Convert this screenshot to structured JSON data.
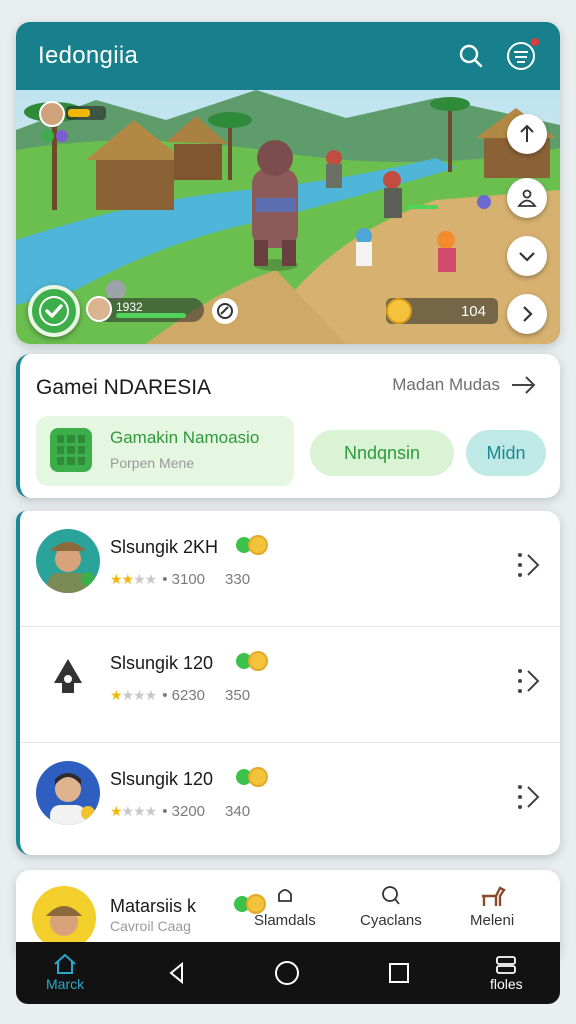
{
  "header": {
    "title": "Iedongiia",
    "search_icon": "search-icon",
    "menu_icon": "menu-icon"
  },
  "game_hud": {
    "health_value": "1932",
    "health_fraction": 0.85,
    "coins": "104"
  },
  "side_controls": [
    "arrow-up-icon",
    "person-icon",
    "chevron-down-icon",
    "chevron-right-icon"
  ],
  "game_card": {
    "title": "Gamei NDARESIA",
    "link_label": "Madan Mudas",
    "feature_title": "Gamakin Namoasio",
    "feature_sub": "Porpen Mene",
    "primary_button": "Nndqnsin",
    "secondary_button": "Midn"
  },
  "players": [
    {
      "name": "Slsungik 2KH",
      "rating": 2.5,
      "score": "3100",
      "points": "330"
    },
    {
      "name": "Slsungik 120",
      "rating": 1,
      "score": "6230",
      "points": "350"
    },
    {
      "name": "Slsungik 120",
      "rating": 1,
      "score": "3200",
      "points": "340"
    }
  ],
  "bottom_card": {
    "name": "Matarsiis k",
    "sub": "Cavroil Caag",
    "tabs": [
      "Slamdals",
      "Cyaclans",
      "Meleni"
    ]
  },
  "navbar": {
    "home_label": "Marck",
    "right_label": "floles"
  },
  "colors": {
    "primary": "#17808c",
    "accent_green": "#3cae4a",
    "star": "#f2b705"
  }
}
